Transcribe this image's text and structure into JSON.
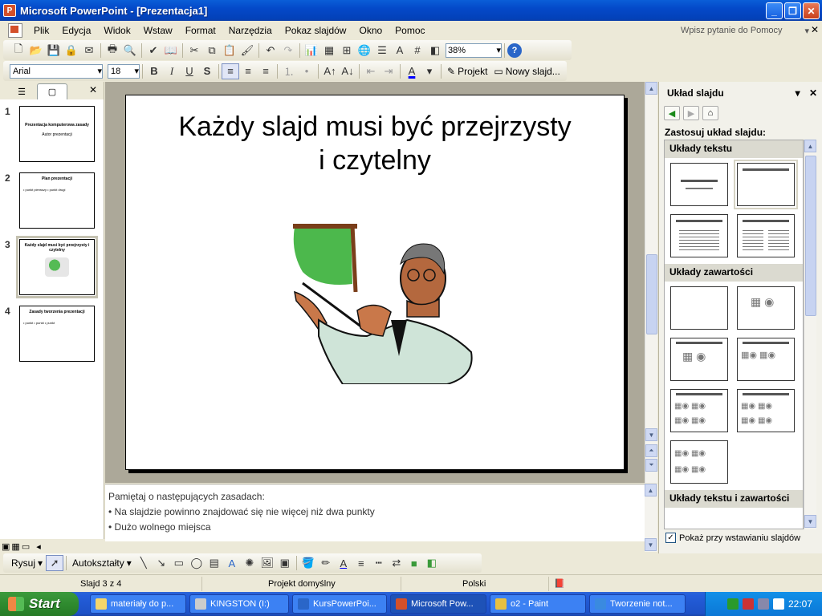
{
  "window": {
    "title": "Microsoft PowerPoint - [Prezentacja1]",
    "app_icon": "powerpoint-icon",
    "minimize": "_",
    "maximize": "❐",
    "close": "✕"
  },
  "menu": {
    "items": [
      "Plik",
      "Edycja",
      "Widok",
      "Wstaw",
      "Format",
      "Narzędzia",
      "Pokaz slajdów",
      "Okno",
      "Pomoc"
    ],
    "help_placeholder": "Wpisz pytanie do Pomocy",
    "doc_close": "✕"
  },
  "standard_toolbar": {
    "zoom": "38%"
  },
  "formatting_toolbar": {
    "font": "Arial",
    "size": "18",
    "bold": "B",
    "italic": "I",
    "underline": "U",
    "shadow": "S",
    "design_button": "Projekt",
    "new_slide_button": "Nowy slajd..."
  },
  "left_pane": {
    "tab_outline": "☰",
    "tab_slides": "▢",
    "close": "✕",
    "slides": [
      {
        "num": "1",
        "title": "Prezentacja komputerowa zasady",
        "sub": "Autor prezentacji"
      },
      {
        "num": "2",
        "title": "Plan prezentacji",
        "sub": "• punkt pierwszy  • punkt drugi"
      },
      {
        "num": "3",
        "title": "Każdy slajd musi być przejrzysty i czytelny",
        "sub": ""
      },
      {
        "num": "4",
        "title": "Zasady tworzenia prezentacji",
        "sub": "• punkt  • punkt  • punkt"
      }
    ]
  },
  "slide": {
    "title_line1": "Każdy slajd musi być przejrzysty",
    "title_line2": "i czytelny"
  },
  "notes": {
    "line1": "Pamiętaj o następujących zasadach:",
    "bullet1": "Na slajdzie powinno znajdować się nie więcej niż dwa punkty",
    "bullet2": "Dużo wolnego miejsca"
  },
  "task_pane": {
    "title": "Układ slajdu",
    "apply_label": "Zastosuj układ slajdu:",
    "group_text": "Układy tekstu",
    "group_content": "Układy zawartości",
    "group_text_content": "Układy tekstu i zawartości",
    "show_on_insert": "Pokaż przy wstawianiu slajdów",
    "check": "✓"
  },
  "draw_toolbar": {
    "draw": "Rysuj",
    "autoshapes": "Autokształty"
  },
  "status": {
    "slide": "Slajd 3 z 4",
    "design": "Projekt domyślny",
    "language": "Polski"
  },
  "taskbar": {
    "start": "Start",
    "tasks": [
      "materiały do p...",
      "KINGSTON (I:)",
      "KursPowerPoi...",
      "Microsoft Pow...",
      "o2 - Paint",
      "Tworzenie not..."
    ],
    "time": "22:07"
  }
}
